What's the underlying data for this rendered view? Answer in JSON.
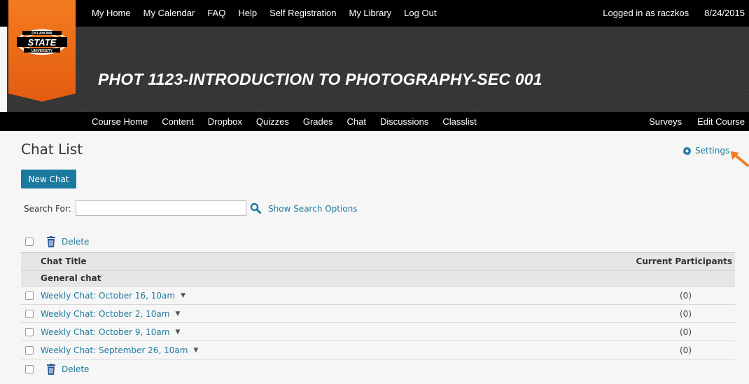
{
  "topnav": {
    "items": [
      "My Home",
      "My Calendar",
      "FAQ",
      "Help",
      "Self Registration",
      "My Library",
      "Log Out"
    ],
    "logged_in": "Logged in as raczkos",
    "date": "8/24/2015"
  },
  "logo": {
    "top_text": "OKLAHOMA",
    "main_text": "STATE",
    "bottom_text": "UNIVERSITY",
    "color": "#f47b20"
  },
  "course": {
    "title": "PHOT 1123-INTRODUCTION TO PHOTOGRAPHY-SEC 001"
  },
  "coursenav": {
    "items": [
      "Course Home",
      "Content",
      "Dropbox",
      "Quizzes",
      "Grades",
      "Chat",
      "Discussions",
      "Classlist"
    ],
    "right_items": [
      "Surveys",
      "Edit Course"
    ]
  },
  "page": {
    "title": "Chat List",
    "settings_label": "Settings",
    "new_chat_label": "New Chat"
  },
  "search": {
    "label": "Search For:",
    "value": "",
    "placeholder": "",
    "options_label": "Show Search Options"
  },
  "actions": {
    "delete_label": "Delete"
  },
  "table": {
    "col_title": "Chat Title",
    "col_participants": "Current Participants",
    "group": "General chat",
    "rows": [
      {
        "title": "Weekly Chat: October 16, 10am",
        "participants": "(0)"
      },
      {
        "title": "Weekly Chat: October 2, 10am",
        "participants": "(0)"
      },
      {
        "title": "Weekly Chat: October 9, 10am",
        "participants": "(0)"
      },
      {
        "title": "Weekly Chat: September 26, 10am",
        "participants": "(0)"
      }
    ]
  },
  "icons": {
    "settings": "gear-icon",
    "search": "search-icon",
    "delete": "trash-icon",
    "menu": "caret-down-icon"
  },
  "colors": {
    "link": "#1f7a9e",
    "button": "#1a7a9e",
    "arrow": "#f47b20"
  }
}
